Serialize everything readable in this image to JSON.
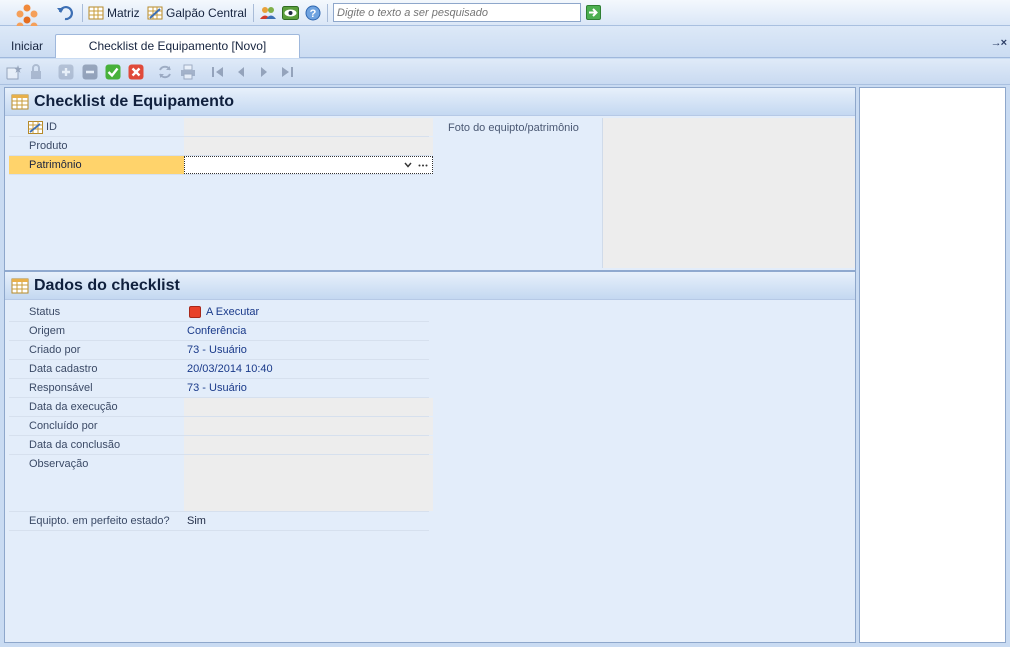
{
  "topbar": {
    "matriz_label": "Matriz",
    "galpao_label": "Galpão Central",
    "search_placeholder": "Digite o texto a ser pesquisado"
  },
  "tabs": {
    "home_label": "Iniciar",
    "active_tab_label": "Checklist de Equipamento [Novo]",
    "pin_close": "→×"
  },
  "section1": {
    "title": "Checklist de Equipamento",
    "fields": [
      {
        "label": "ID",
        "value": ""
      },
      {
        "label": "Produto",
        "value": ""
      },
      {
        "label": "Patrimônio",
        "value": ""
      }
    ],
    "photo_label": "Foto do equipto/patrimônio"
  },
  "section2": {
    "title": "Dados do checklist",
    "fields": [
      {
        "label": "Status",
        "value": "A Executar"
      },
      {
        "label": "Origem",
        "value": "Conferência"
      },
      {
        "label": "Criado por",
        "value": "73 - Usuário"
      },
      {
        "label": "Data cadastro",
        "value": "20/03/2014 10:40"
      },
      {
        "label": "Responsável",
        "value": "73 - Usuário"
      },
      {
        "label": "Data da execução",
        "value": ""
      },
      {
        "label": "Concluído por",
        "value": ""
      },
      {
        "label": "Data da conclusão",
        "value": ""
      },
      {
        "label": "Observação",
        "value": ""
      },
      {
        "label": "Equipto. em perfeito estado?",
        "value": "Sim"
      }
    ]
  },
  "colors": {
    "accent": "#ffd36b",
    "status_badge": "#e8412a"
  }
}
